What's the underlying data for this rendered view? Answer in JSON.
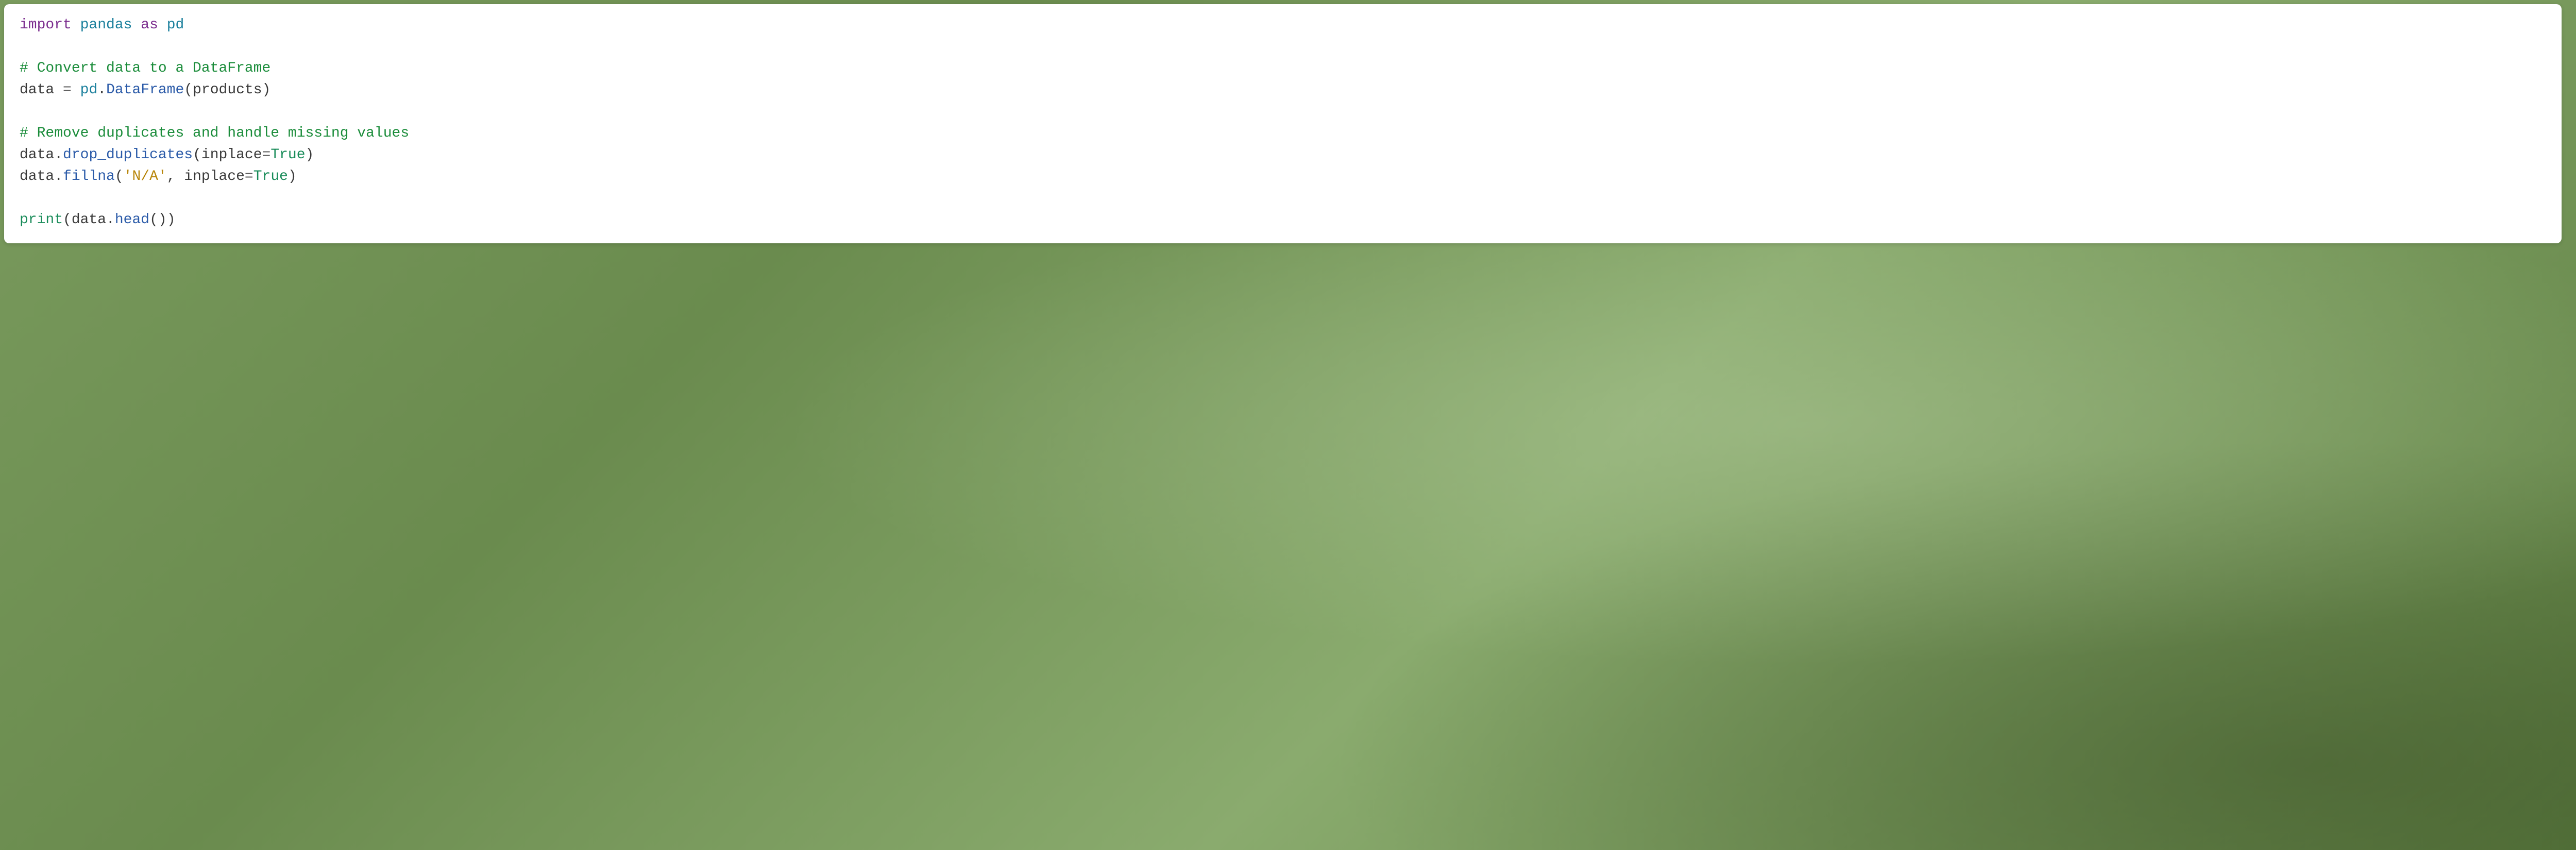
{
  "code": {
    "l1": {
      "import": "import",
      "pandas": "pandas",
      "as": "as",
      "pd": "pd"
    },
    "l3": "# Convert data to a DataFrame",
    "l4": {
      "data": "data",
      "eq": " = ",
      "pd": "pd",
      "dot": ".",
      "DataFrame": "DataFrame",
      "open": "(",
      "products": "products",
      "close": ")"
    },
    "l6": "# Remove duplicates and handle missing values",
    "l7": {
      "data": "data",
      "dot": ".",
      "method": "drop_duplicates",
      "open": "(",
      "param": "inplace",
      "eq": "=",
      "val": "True",
      "close": ")"
    },
    "l8": {
      "data": "data",
      "dot": ".",
      "method": "fillna",
      "open": "(",
      "str": "'N/A'",
      "comma": ", ",
      "param": "inplace",
      "eq": "=",
      "val": "True",
      "close": ")"
    },
    "l10": {
      "print": "print",
      "open1": "(",
      "data": "data",
      "dot": ".",
      "head": "head",
      "open2": "(",
      "close2": ")",
      "close1": ")"
    }
  }
}
